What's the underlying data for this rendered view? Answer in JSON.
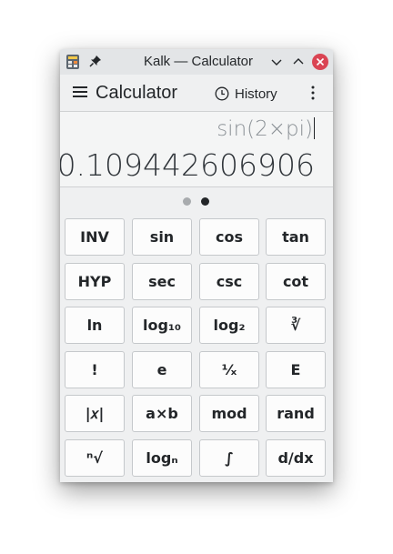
{
  "window": {
    "title": "Kalk — Calculator"
  },
  "header": {
    "title": "Calculator",
    "history_label": "History"
  },
  "display": {
    "expression": "sin(2×pi)",
    "result": "0.109442606906"
  },
  "pager": {
    "pages": 2,
    "current": 2
  },
  "keys": [
    [
      "INV",
      "sin",
      "cos",
      "tan"
    ],
    [
      "HYP",
      "sec",
      "csc",
      "cot"
    ],
    [
      "ln",
      "log₁₀",
      "log₂",
      "∛"
    ],
    [
      "!",
      "e",
      "⅟ₓ",
      "E"
    ],
    [
      "|𝑥|",
      "a×b",
      "mod",
      "rand"
    ],
    [
      "ⁿ√",
      "logₙ",
      "∫",
      "d/dx"
    ]
  ],
  "icons": {
    "app": "calculator-app-icon",
    "pin": "pin-icon",
    "minimize": "chevron-down-icon",
    "maximize": "chevron-up-icon",
    "close": "close-icon",
    "menu": "hamburger-icon",
    "history": "clock-icon",
    "more": "kebab-menu-icon"
  },
  "colors": {
    "close_button": "#da4453",
    "window_bg": "#eff0f1",
    "key_bg": "#fcfcfc"
  }
}
